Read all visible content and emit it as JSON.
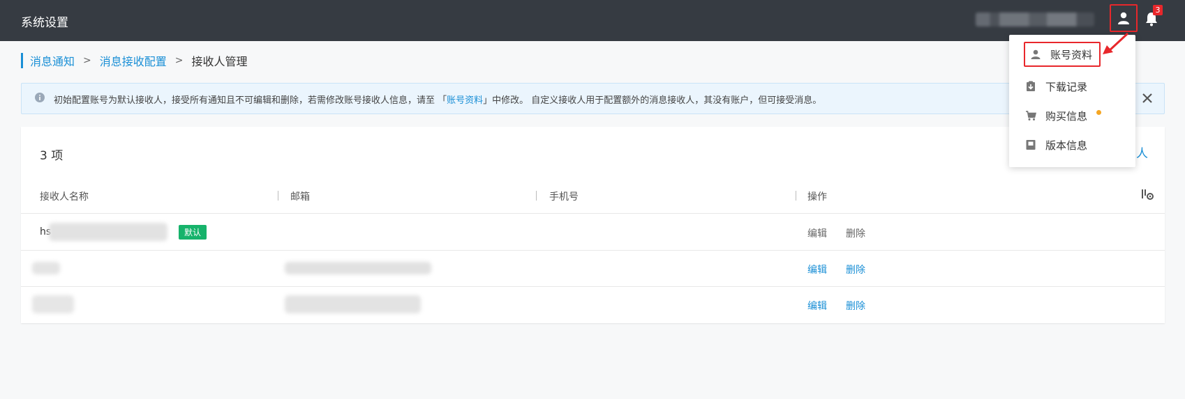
{
  "topbar": {
    "title": "系统设置",
    "notification_count": "3",
    "user_icon": "user-icon",
    "bell_icon": "bell-icon"
  },
  "breadcrumb": {
    "items": [
      "消息通知",
      "消息接收配置"
    ],
    "current": "接收人管理"
  },
  "alert": {
    "text_before": "初始配置账号为默认接收人，接受所有通知且不可编辑和删除，若需修改账号接收人信息，请至 「",
    "link": "账号资料",
    "text_after": "」中修改。 自定义接收人用于配置额外的消息接收人，其没有账户，但可接受消息。"
  },
  "table": {
    "count_label": "3 项",
    "add_label_fragment": "人",
    "columns": [
      "接收人名称",
      "邮箱",
      "手机号",
      "操作"
    ],
    "rows": [
      {
        "name_prefix": "hs",
        "tag": "默认",
        "edit": "编辑",
        "delete": "删除",
        "editable": false
      },
      {
        "name_prefix": "",
        "tag": "",
        "edit": "编辑",
        "delete": "删除",
        "editable": true
      },
      {
        "name_prefix": "",
        "tag": "",
        "edit": "编辑",
        "delete": "删除",
        "editable": true
      }
    ]
  },
  "dropdown": {
    "items": [
      {
        "label": "账号资料",
        "icon": "person-icon"
      },
      {
        "label": "下载记录",
        "icon": "download-clipboard-icon"
      },
      {
        "label": "购买信息",
        "icon": "cart-icon"
      },
      {
        "label": "版本信息",
        "icon": "book-icon"
      }
    ]
  },
  "colors": {
    "topbar": "#363b42",
    "link": "#1a8fd6",
    "highlight": "#e8272b",
    "tag": "#16b36b",
    "dot": "#f5a623"
  }
}
